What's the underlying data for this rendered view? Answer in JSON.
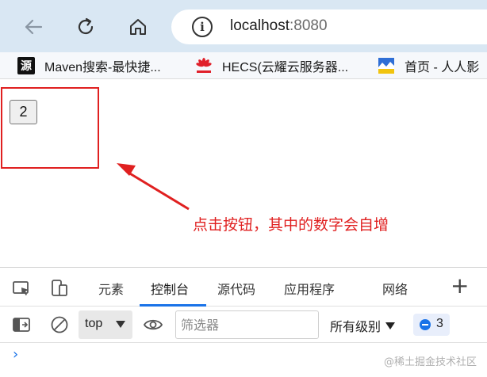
{
  "browser": {
    "address": {
      "host": "localhost",
      "port": ":8080"
    },
    "icons": [
      "back-icon",
      "refresh-icon",
      "home-icon",
      "site-info-icon"
    ],
    "bookmarks": [
      {
        "icon_text": "源",
        "label": "Maven搜索-最快捷..."
      },
      {
        "icon_text": "",
        "label": "HECS(云耀云服务器..."
      },
      {
        "icon_text": "",
        "label": "首页 - 人人影"
      }
    ]
  },
  "page": {
    "button_label": "2",
    "annotation": "点击按钮，其中的数字会自增"
  },
  "devtools": {
    "tabs": [
      {
        "label": "元素",
        "active": false
      },
      {
        "label": "控制台",
        "active": true
      },
      {
        "label": "源代码",
        "active": false
      },
      {
        "label": "应用程序",
        "active": false
      },
      {
        "label": "网络",
        "active": false
      }
    ],
    "add_tab": "+",
    "context": "top",
    "filter_placeholder": "筛选器",
    "levels": "所有级别",
    "issues_count": "3",
    "prompt": "›"
  },
  "colors": {
    "annotation": "#e02020",
    "accent": "#1a73e8",
    "toolbar": "#d9e7f3"
  },
  "watermark": "@稀土掘金技术社区"
}
